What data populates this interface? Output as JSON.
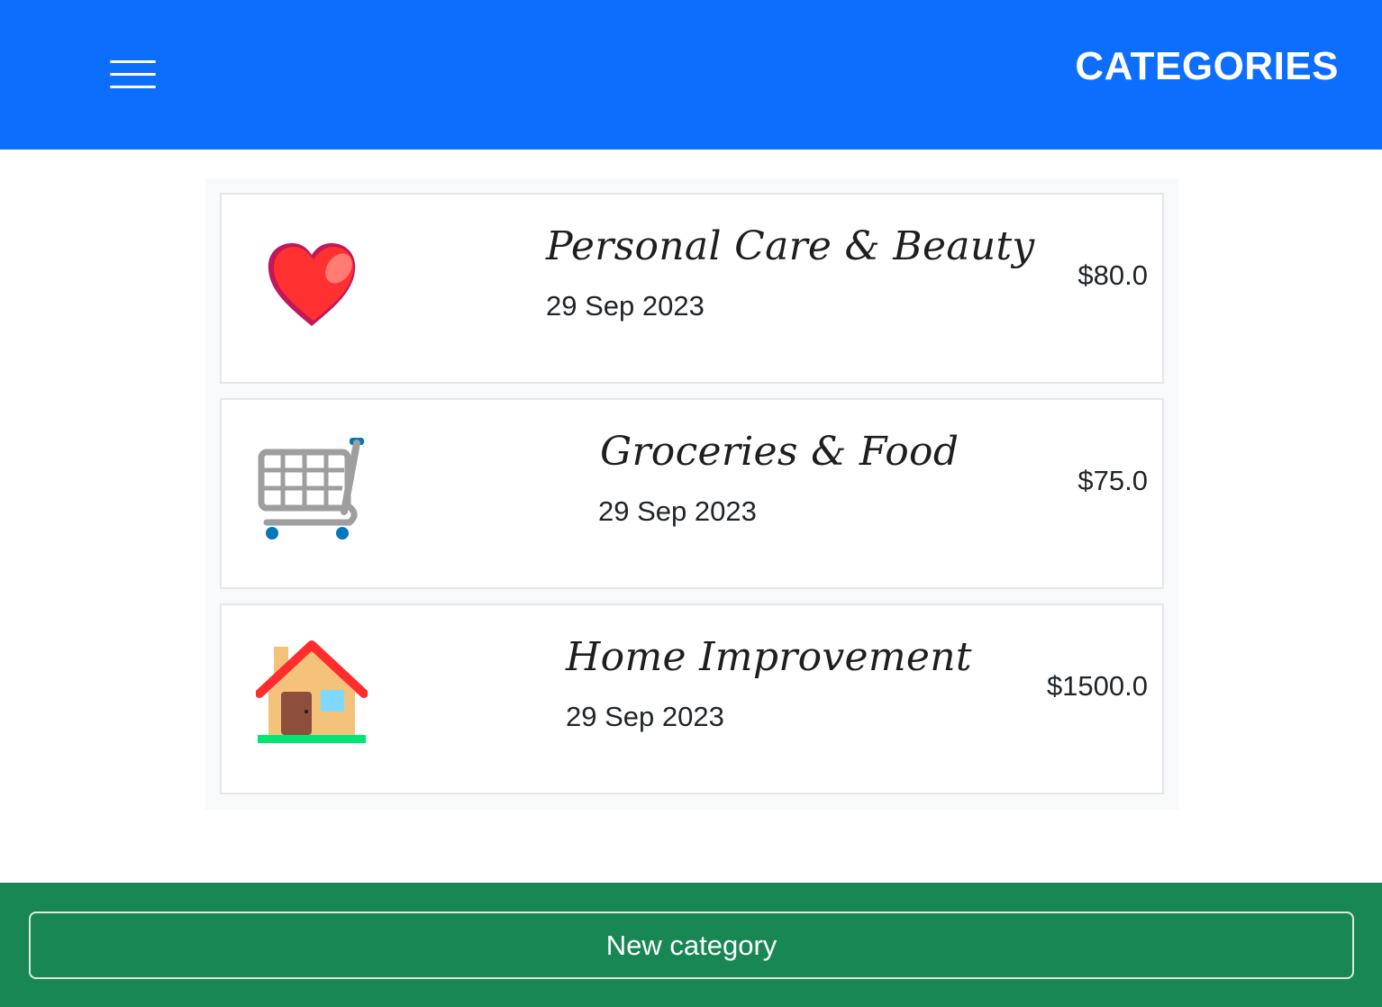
{
  "header": {
    "title": "CATEGORIES",
    "menu_icon": "hamburger-menu-icon"
  },
  "categories": [
    {
      "name": "Personal Care & Beauty",
      "date": "29 Sep 2023",
      "amount": "$80.0",
      "icon": "heart-icon"
    },
    {
      "name": "Groceries & Food",
      "date": "29 Sep 2023",
      "amount": "$75.0",
      "icon": "shopping-cart-icon"
    },
    {
      "name": "Home Improvement",
      "date": "29 Sep 2023",
      "amount": "$1500.0",
      "icon": "house-icon"
    }
  ],
  "footer": {
    "new_button_label": "New category"
  },
  "colors": {
    "header_bg": "#0d6efd",
    "footer_bg": "#198754",
    "panel_bg": "#f8f9fa"
  }
}
